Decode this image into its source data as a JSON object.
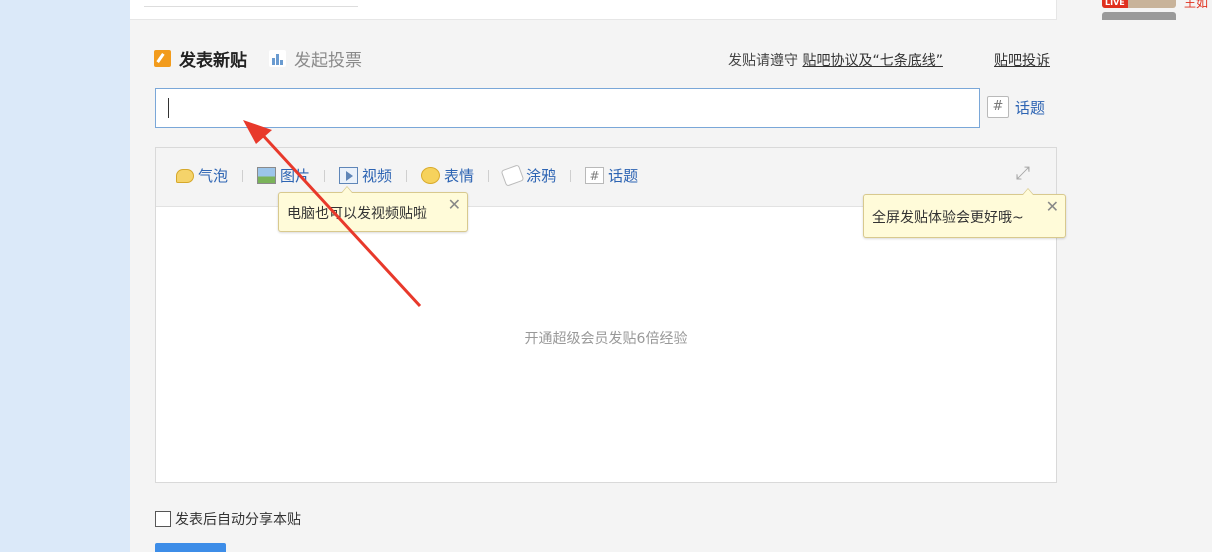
{
  "header": {
    "live_badge": "LIVE",
    "right_text": "王如"
  },
  "tabs": [
    {
      "label": "发表新贴",
      "active": true
    },
    {
      "label": "发起投票",
      "active": false
    }
  ],
  "rules": {
    "prefix": "发贴请遵守",
    "link": "贴吧协议及“七条底线”"
  },
  "complaint_link": "贴吧投诉",
  "title_input": {
    "value": "",
    "placeholder": ""
  },
  "topic_button": {
    "label": "话题"
  },
  "toolbar": {
    "items": [
      {
        "label": "气泡",
        "icon": "bubble-icon"
      },
      {
        "label": "图片",
        "icon": "image-icon"
      },
      {
        "label": "视频",
        "icon": "video-icon"
      },
      {
        "label": "表情",
        "icon": "emoji-icon"
      },
      {
        "label": "涂鸦",
        "icon": "brush-icon"
      },
      {
        "label": "话题",
        "icon": "hashtag-icon"
      }
    ],
    "fullscreen_icon": "fullscreen-icon"
  },
  "tooltips": {
    "video": "电脑也可以发视频贴啦",
    "fullscreen": "全屏发贴体验会更好哦~",
    "close_glyph": "✕"
  },
  "editor": {
    "placeholder": "开通超级会员发贴6倍经验"
  },
  "share_checkbox": {
    "label": "发表后自动分享本贴",
    "checked": false
  },
  "colors": {
    "accent": "#2d64b3",
    "input_border": "#7aa7d8",
    "annotation": "#e8392b"
  }
}
